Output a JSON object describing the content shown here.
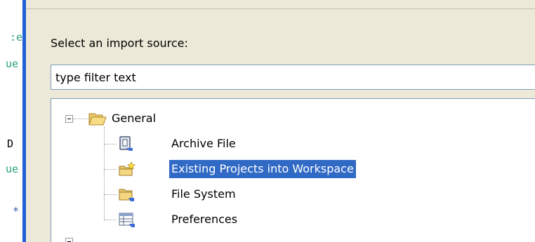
{
  "editor_fragments": [
    ":e",
    "ue",
    "D",
    "ue",
    "*"
  ],
  "dialog": {
    "prompt": "Select an import source:",
    "filter_value": "type filter text"
  },
  "tree": {
    "group": {
      "label": "General",
      "icon": "folder-open-icon",
      "expanded": true
    },
    "items": [
      {
        "label": "Archive File",
        "icon": "archive-file-icon"
      },
      {
        "label": "Existing Projects into Workspace",
        "icon": "existing-projects-icon",
        "selected": true
      },
      {
        "label": "File System",
        "icon": "file-system-folder-icon"
      },
      {
        "label": "Preferences",
        "icon": "preferences-icon"
      }
    ]
  },
  "colors": {
    "selection": "#316ac5",
    "window_border": "#1f5fd9",
    "dialog_bg": "#ece9d8"
  }
}
